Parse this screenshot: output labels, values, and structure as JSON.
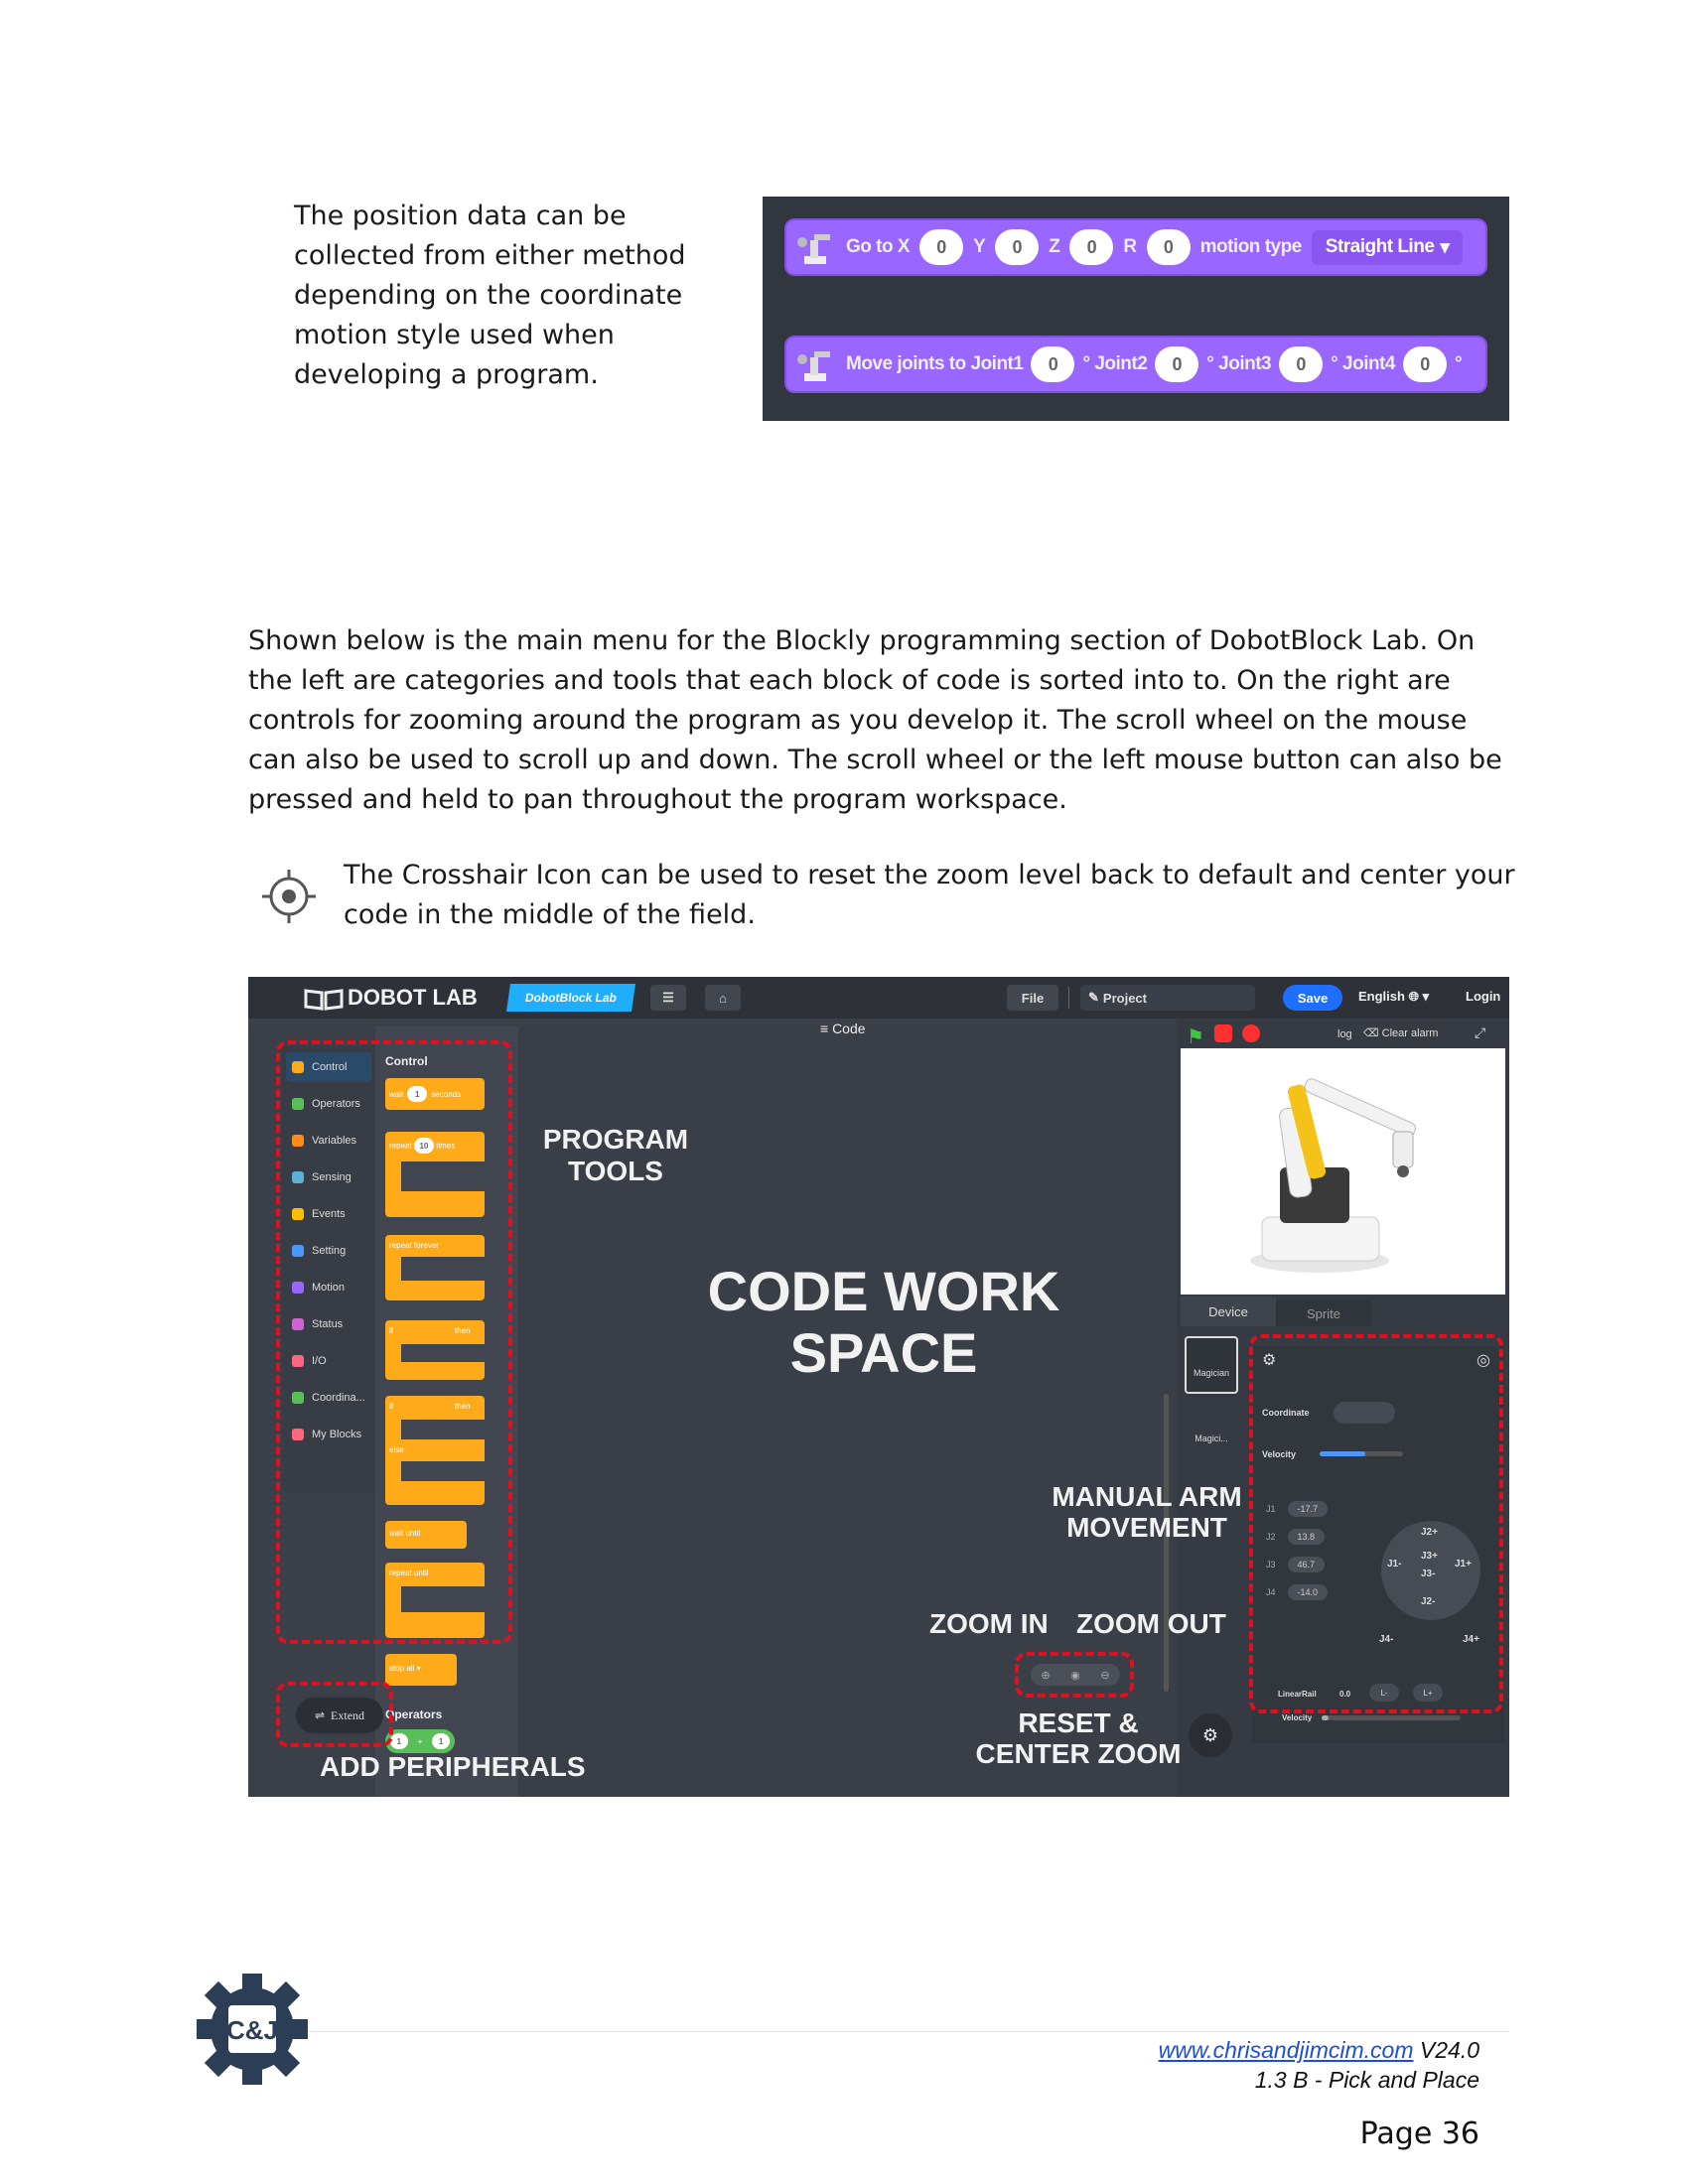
{
  "intro_text": "The position data can be collected from either method depending on the coordinate motion style used when developing a program.",
  "goto_block": {
    "label": "Go to X",
    "x": "0",
    "y_label": "Y",
    "y": "0",
    "z_label": "Z",
    "z": "0",
    "r_label": "R",
    "r": "0",
    "motion_label": "motion type",
    "motion_value": "Straight Line"
  },
  "joints_block": {
    "label": "Move joints to Joint1",
    "j1": "0",
    "j2_label": "° Joint2",
    "j2": "0",
    "j3_label": "° Joint3",
    "j3": "0",
    "j4_label": "° Joint4",
    "j4": "0",
    "deg": "°"
  },
  "main_paragraph": "Shown below is the main menu for the Blockly programming section of DobotBlock Lab. On the left are categories and tools that each block of code is sorted into to. On the right are controls for zooming around the program as you develop it. The scroll wheel on the mouse can also be used to scroll up and down.  The scroll wheel or the left mouse button can also be pressed and held to pan throughout the program workspace.",
  "crosshair_text": "The Crosshair Icon can be used to reset the zoom level back to default and center your code in the middle of the field.",
  "editor": {
    "brand": "DOBOT LAB",
    "badge": "DobotBlock Lab",
    "file_btn": "File",
    "project": "Project",
    "save_btn": "Save",
    "language": "English",
    "login": "Login",
    "code_tab": "Code",
    "log": "log",
    "clear_alarm": "Clear alarm",
    "palette_title": "Control",
    "categories": [
      "Control",
      "Operators",
      "Variables",
      "Sensing",
      "Events",
      "Setting",
      "Motion",
      "Status",
      "I/O",
      "Coordina...",
      "My Blocks"
    ],
    "category_colors": [
      "#ffab19",
      "#59c059",
      "#ff8c1a",
      "#5cb1d6",
      "#ffbf00",
      "#4c97ff",
      "#9966ff",
      "#cf63cf",
      "#ff6680",
      "#59c059",
      "#ff6680"
    ],
    "blocks": {
      "wait": "wait",
      "wait_val": "1",
      "seconds": "seconds",
      "repeat": "repeat",
      "repeat_val": "10",
      "times": "times",
      "repeat_forever": "repeat forever",
      "if": "if",
      "then": "then",
      "else": "else",
      "wait_until": "wait until",
      "repeat_until": "repeat until",
      "stop": "stop",
      "stop_val": "all"
    },
    "operators_title": "Operators",
    "op_a": "1",
    "op_b": "1",
    "extend_btn": "Extend",
    "device_tab": "Device",
    "sprite_tab": "Sprite",
    "device_name": "Magician",
    "device_name2": "Magici...",
    "coordinate_label": "Coordinate",
    "velocity_label": "Velocity",
    "velocity_level": 0.55,
    "joints": [
      {
        "name": "J1",
        "value": "-17.7"
      },
      {
        "name": "J2",
        "value": "13.8"
      },
      {
        "name": "J3",
        "value": "46.7"
      },
      {
        "name": "J4",
        "value": "-14.0"
      }
    ],
    "jog": {
      "j2p": "J2+",
      "j3p": "J3+",
      "j1m": "J1-",
      "j1p": "J1+",
      "j3m": "J3-",
      "j2m": "J2-",
      "j4m": "J4-",
      "j4p": "J4+"
    },
    "linear_rail_label": "LinearRail",
    "linear_rail_value": "0.0",
    "lminus": "L-",
    "lplus": "L+",
    "rail_velocity_label": "Velocity",
    "rail_velocity_level": 0.05
  },
  "annotations": {
    "program_tools": [
      "PROGRAM",
      "TOOLS"
    ],
    "code_workspace": [
      "CODE WORK",
      "SPACE"
    ],
    "manual_arm": [
      "MANUAL ARM",
      "MOVEMENT"
    ],
    "zoom_in": "ZOOM IN",
    "zoom_out": "ZOOM OUT",
    "reset_center": [
      "RESET &",
      "CENTER ZOOM"
    ],
    "add_peripherals": "ADD PERIPHERALS"
  },
  "footer": {
    "url": "www.chrisandjimcim.com",
    "version": " V24.0",
    "chapter": "1.3 B - Pick and Place",
    "page": "Page 36",
    "logo_text": "C&J"
  },
  "colors": {
    "block_purple": "#9966ff",
    "control_orange": "#ffab19",
    "annot_red": "#e01020",
    "save_blue": "#1e6fff",
    "footer_logo": "#2c3e55"
  }
}
